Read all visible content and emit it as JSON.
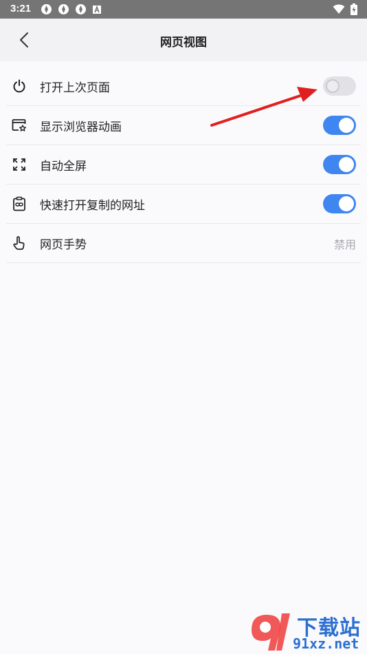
{
  "status_bar": {
    "time": "3:21",
    "left_icons": [
      "app-notification-icon",
      "app-notification-icon",
      "app-notification-icon",
      "a-square-icon"
    ],
    "right_icons": [
      "wifi-icon",
      "battery-icon"
    ]
  },
  "header": {
    "title": "网页视图",
    "back_icon": "chevron-left-icon"
  },
  "settings": [
    {
      "icon": "power-icon",
      "label": "打开上次页面",
      "control": "toggle",
      "on": false
    },
    {
      "icon": "browser-star-icon",
      "label": "显示浏览器动画",
      "control": "toggle",
      "on": true
    },
    {
      "icon": "fullscreen-icon",
      "label": "自动全屏",
      "control": "toggle",
      "on": true
    },
    {
      "icon": "clipboard-link-icon",
      "label": "快速打开复制的网址",
      "control": "toggle",
      "on": true
    },
    {
      "icon": "gesture-hand-icon",
      "label": "网页手势",
      "control": "value",
      "value": "禁用"
    }
  ],
  "colors": {
    "accent": "#3f86f0",
    "annotation_arrow": "#e02020",
    "header_bg": "#f2f2f4",
    "status_bar_bg": "#757575"
  },
  "watermark": {
    "text": "下载站",
    "url": "91xz.net"
  }
}
